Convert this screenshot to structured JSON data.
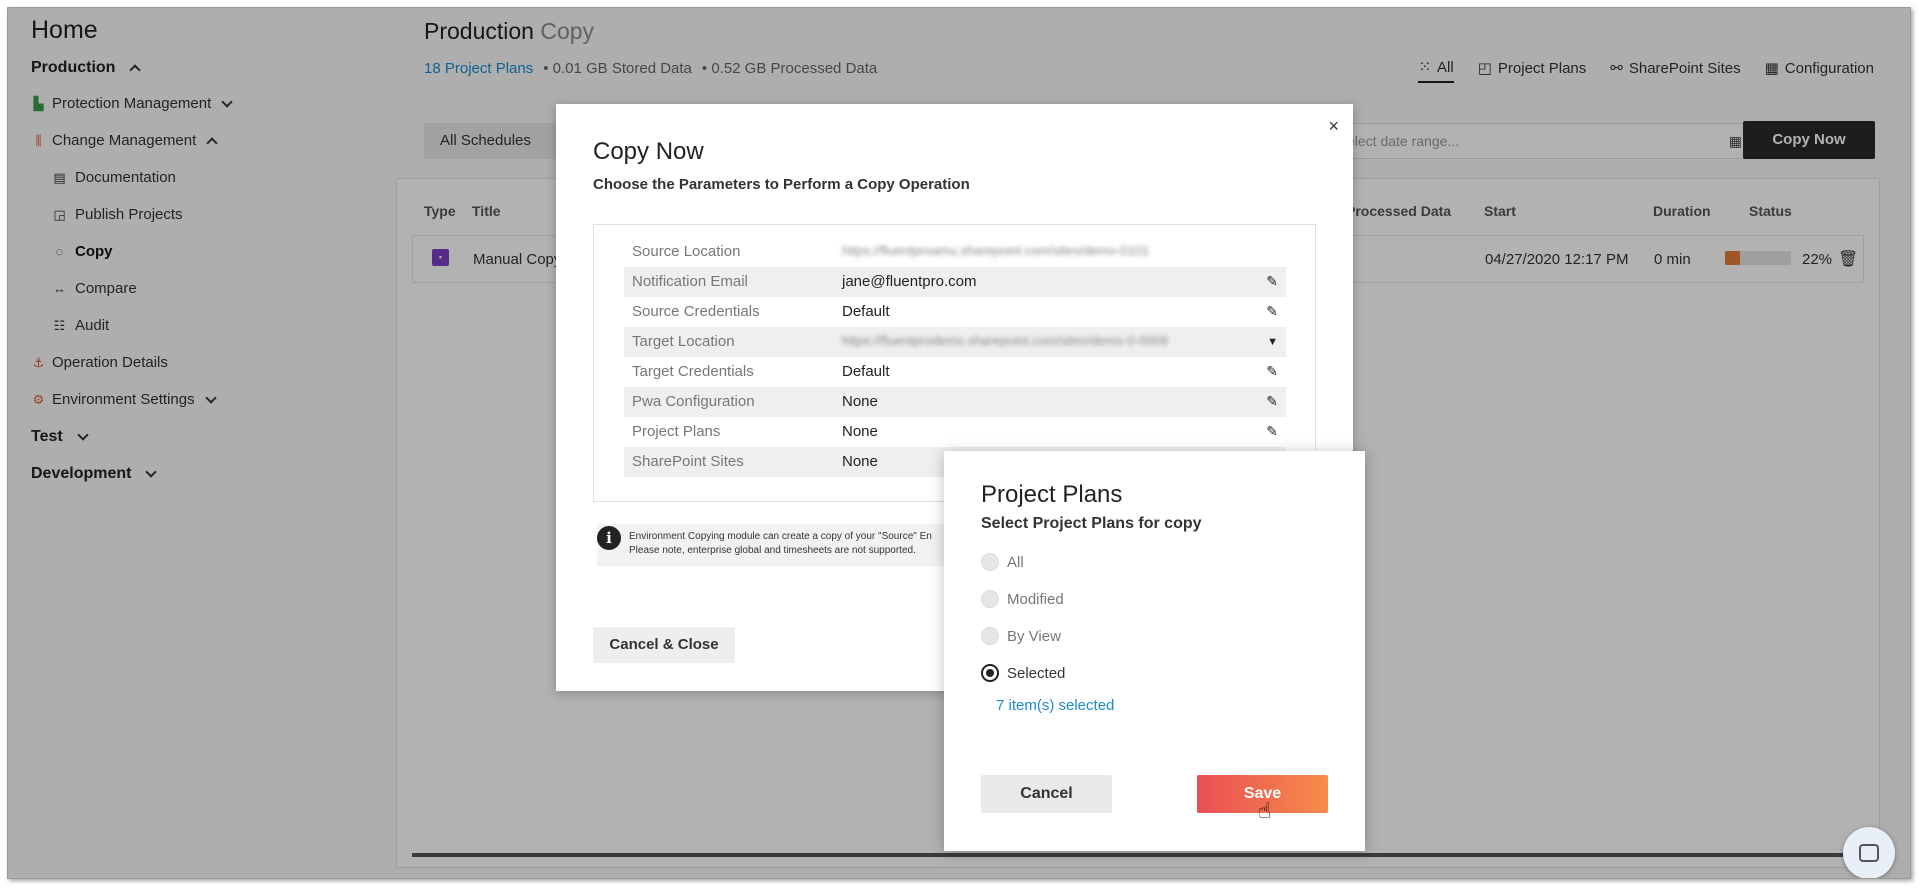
{
  "sidebar": {
    "home": "Home",
    "production": "Production",
    "items": [
      {
        "label": "Protection Management"
      },
      {
        "label": "Change Management"
      },
      {
        "label": "Operation Details"
      },
      {
        "label": "Environment Settings"
      }
    ],
    "sub_items": [
      {
        "label": "Documentation"
      },
      {
        "label": "Publish Projects"
      },
      {
        "label": "Copy"
      },
      {
        "label": "Compare"
      },
      {
        "label": "Audit"
      }
    ],
    "test": "Test",
    "development": "Development"
  },
  "header": {
    "title": "Production",
    "subtitle": "Copy",
    "project_plans_count": "18 Project Plans",
    "stored_data": "• 0.01 GB Stored Data",
    "processed_data": "• 0.52 GB Processed Data",
    "tabs": [
      "All",
      "Project Plans",
      "SharePoint Sites",
      "Configuration"
    ]
  },
  "toolbar": {
    "schedules": "All Schedules",
    "date_placeholder": "elect date range...",
    "copy_now": "Copy Now"
  },
  "table": {
    "headers": {
      "type": "Type",
      "title": "Title",
      "processed": "Processed Data",
      "start": "Start",
      "duration": "Duration",
      "status": "Status"
    },
    "row": {
      "title": "Manual Copy",
      "start": "04/27/2020 12:17 PM",
      "duration": "0 min",
      "progress": 0.22,
      "progress_label": "22%"
    }
  },
  "copy_modal": {
    "title": "Copy Now",
    "subtitle": "Choose the Parameters to Perform a Copy Operation",
    "params": [
      {
        "key": "Source Location",
        "value": "https://fluentproamu.sharepoint.com/sites/demo-0101"
      },
      {
        "key": "Notification Email",
        "value": "jane@fluentpro.com"
      },
      {
        "key": "Source Credentials",
        "value": "Default"
      },
      {
        "key": "Target Location",
        "value": "https://fluentprodemo.sharepoint.com/sites/demo-0-0009"
      },
      {
        "key": "Target Credentials",
        "value": "Default"
      },
      {
        "key": "Pwa Configuration",
        "value": "None"
      },
      {
        "key": "Project Plans",
        "value": "None"
      },
      {
        "key": "SharePoint Sites",
        "value": "None"
      }
    ],
    "info_line1": "Environment Copying module can create a copy of your \"Source\" En",
    "info_line2": "Please note, enterprise global and timesheets are not supported.",
    "cancel_close": "Cancel & Close"
  },
  "project_plans_dialog": {
    "title": "Project Plans",
    "subtitle": "Select Project Plans for copy",
    "options": [
      "All",
      "Modified",
      "By View",
      "Selected"
    ],
    "selected_option": "Selected",
    "selected_link": "7 item(s) selected",
    "cancel": "Cancel",
    "save": "Save"
  }
}
